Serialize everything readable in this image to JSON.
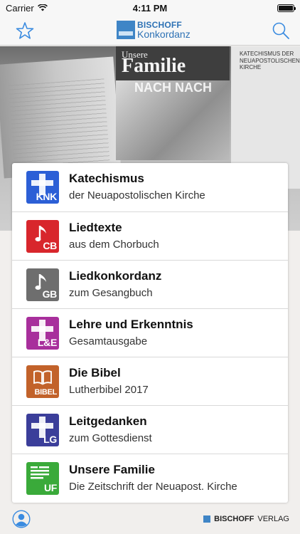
{
  "status": {
    "carrier": "Carrier",
    "time": "4:11 PM"
  },
  "header": {
    "logo_line1": "BISCHOFF",
    "logo_line2": "Konkordanz"
  },
  "hero": {
    "magazine_title_small": "Unsere",
    "magazine_title_big": "Familie",
    "magazine_sub": "NACH NACH",
    "book_title": "KATECHISMUS DER NEUAPOSTOLISCHEN KIRCHE"
  },
  "items": [
    {
      "title": "Katechismus",
      "subtitle": "der Neuapostolischen Kirche",
      "abbr": "KNK",
      "color": "#2c5fd6",
      "icon": "cross-icon"
    },
    {
      "title": "Liedtexte",
      "subtitle": "aus dem Chorbuch",
      "abbr": "CB",
      "color": "#d8262c",
      "icon": "music-note-icon"
    },
    {
      "title": "Liedkonkordanz",
      "subtitle": "zum Gesangbuch",
      "abbr": "GB",
      "color": "#6e6e6e",
      "icon": "music-note-icon"
    },
    {
      "title": "Lehre und Erkenntnis",
      "subtitle": "Gesamtausgabe",
      "abbr": "L&E",
      "color": "#a82f9c",
      "icon": "cross-icon"
    },
    {
      "title": "Die Bibel",
      "subtitle": "Lutherbibel 2017",
      "abbr": "BIBEL",
      "color": "#c2622a",
      "icon": "book-icon"
    },
    {
      "title": "Leitgedanken",
      "subtitle": "zum Gottesdienst",
      "abbr": "LG",
      "color": "#3b3e9a",
      "icon": "cross-icon"
    },
    {
      "title": "Unsere Familie",
      "subtitle": "Die Zeitschrift der Neuapost. Kirche",
      "abbr": "UF",
      "color": "#3aaa3a",
      "icon": "document-lines-icon"
    }
  ],
  "footer": {
    "publisher_bold": "BISCHOFF",
    "publisher_rest": "VERLAG"
  },
  "colors": {
    "accent": "#3f85c6",
    "nav_icon": "#3a8be0"
  }
}
